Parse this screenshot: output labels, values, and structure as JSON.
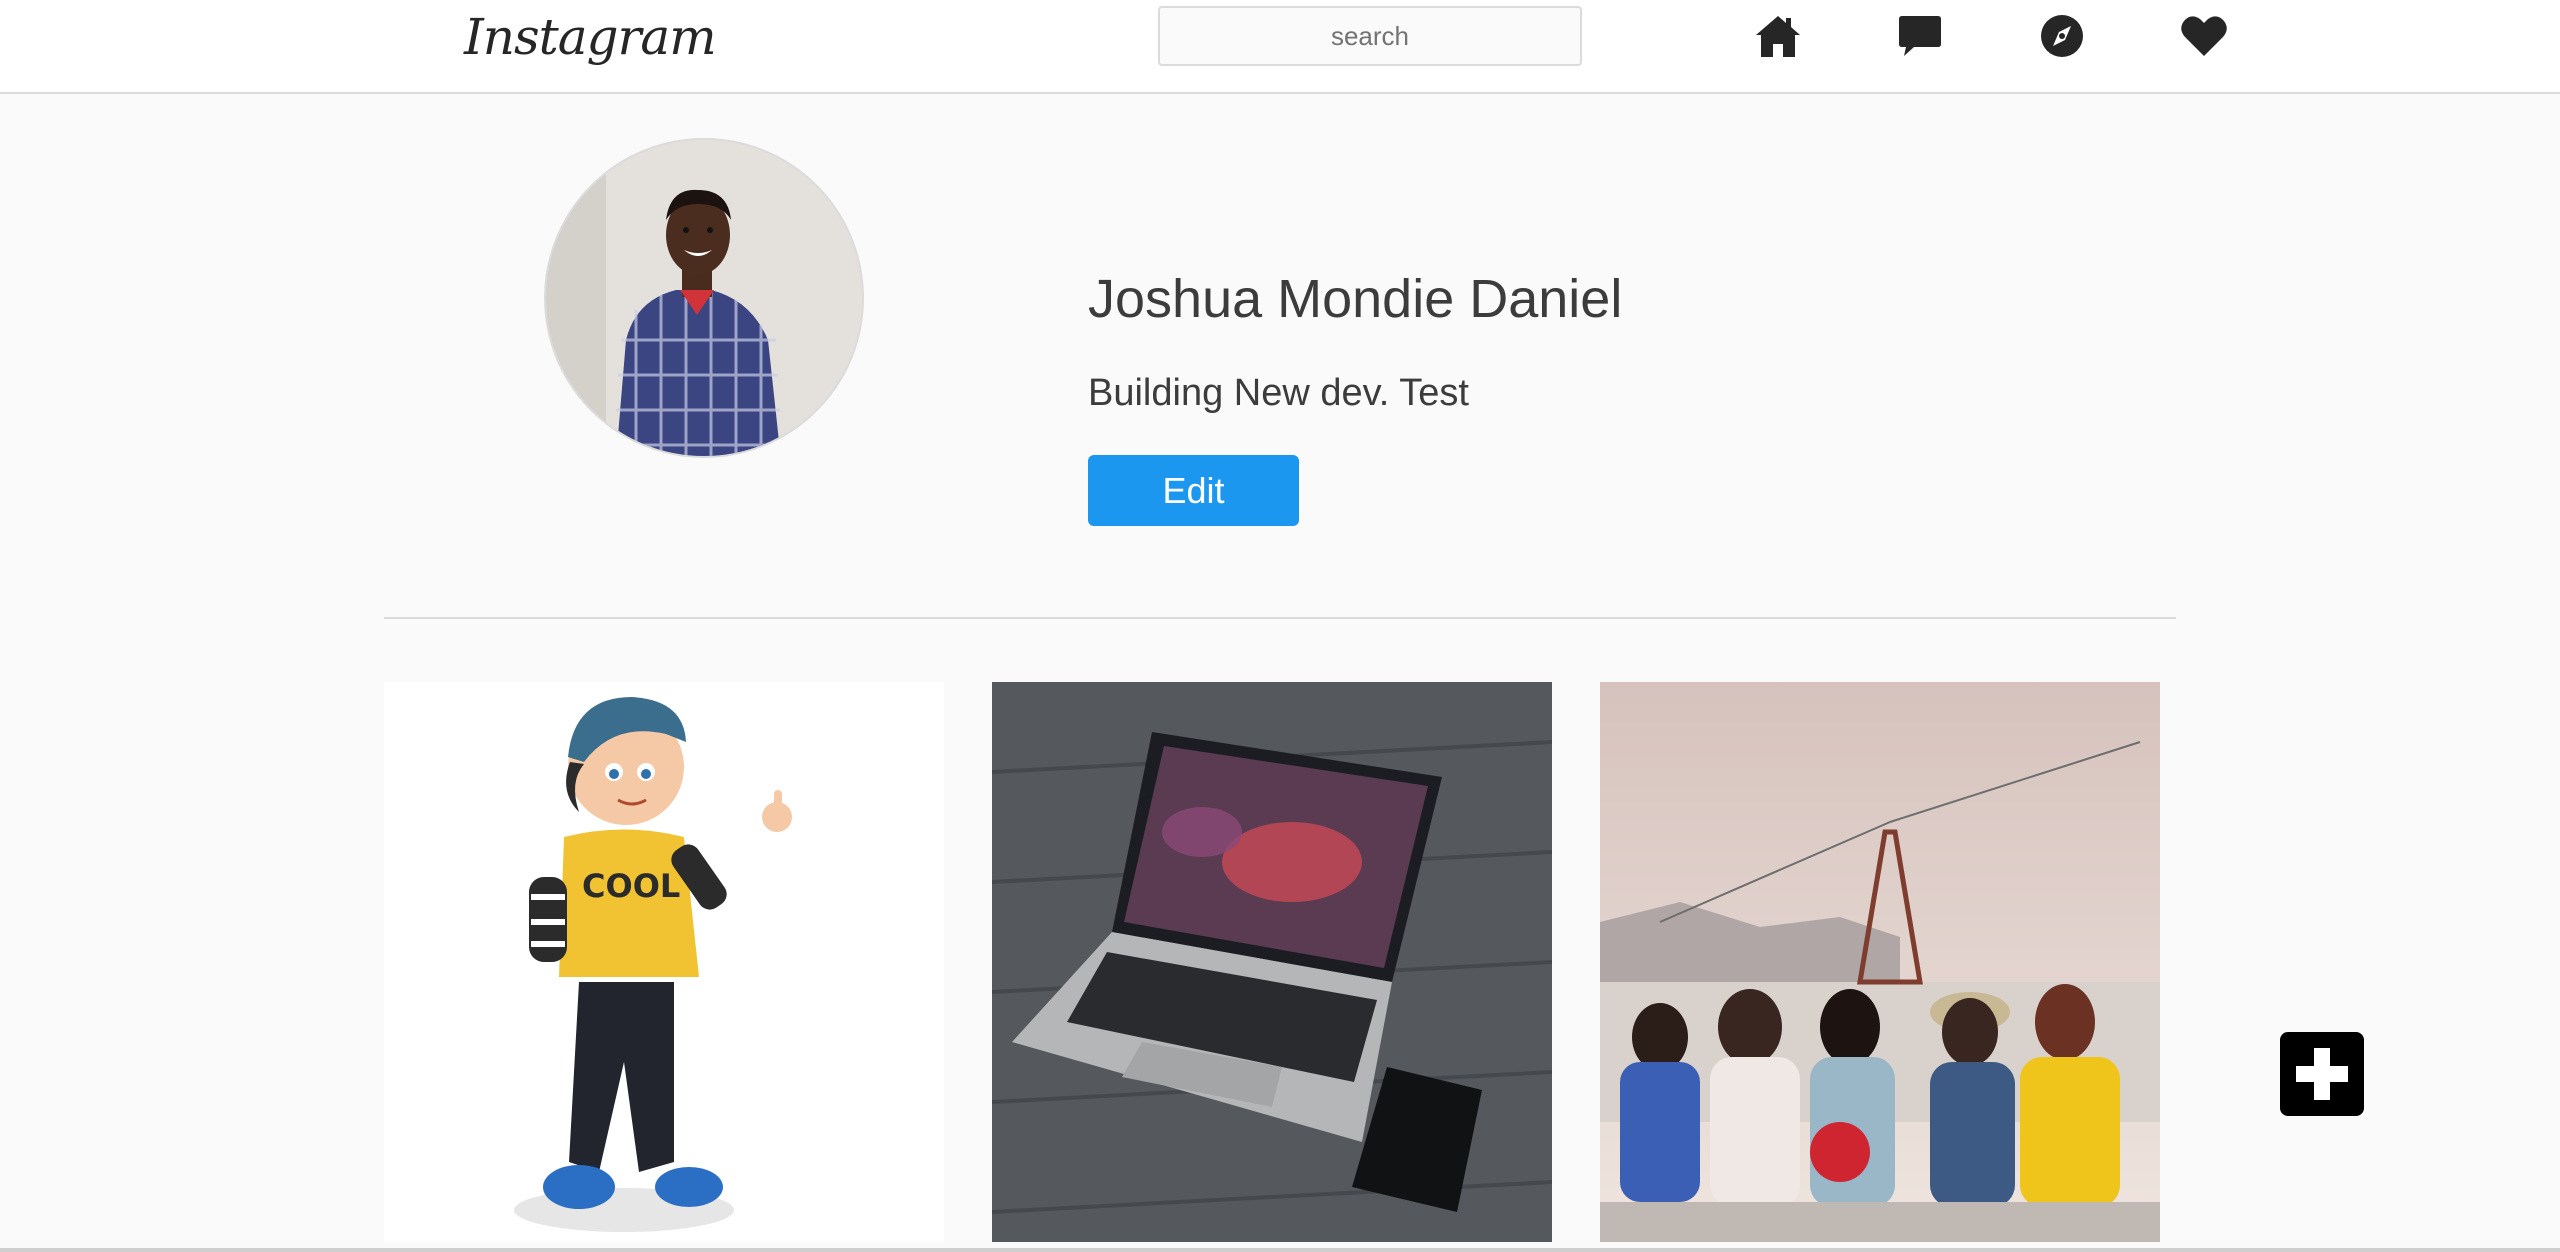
{
  "header": {
    "logo_text": "Instagram",
    "search_placeholder": "search",
    "nav_icons": [
      "home-icon",
      "message-icon",
      "compass-icon",
      "heart-icon"
    ]
  },
  "profile": {
    "name": "Joshua Mondie Daniel",
    "bio": "Building New dev. Test",
    "edit_label": "Edit"
  },
  "posts": [
    {
      "subject": "cartoon boy with cap giving thumbs up"
    },
    {
      "subject": "laptop and phone on wooden floor"
    },
    {
      "subject": "friends sitting by the sea with cable car"
    }
  ],
  "colors": {
    "accent": "#1b97f0",
    "background": "#fafafa",
    "border": "#dbdbdb"
  }
}
